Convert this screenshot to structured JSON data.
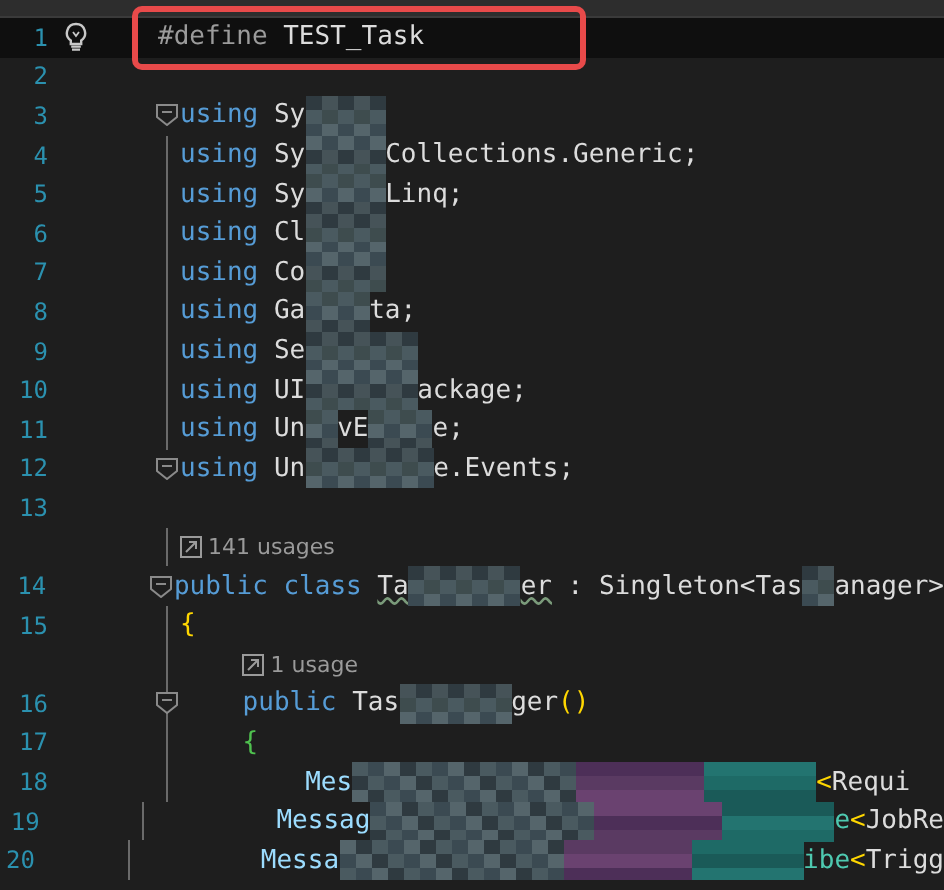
{
  "editor": {
    "rows": [
      {
        "kind": "code",
        "number": "1",
        "current": true,
        "annotated": true,
        "lightbulb": true,
        "fold_marker": false,
        "guide": false,
        "segments": [
          {
            "kind": "directive",
            "text": "#define"
          },
          {
            "kind": "plain",
            "text": " TEST_Task"
          }
        ]
      },
      {
        "kind": "code",
        "number": "2",
        "current": false,
        "annotated": false,
        "lightbulb": false,
        "fold_marker": false,
        "guide": false,
        "segments": []
      },
      {
        "kind": "code",
        "number": "3",
        "current": false,
        "annotated": false,
        "lightbulb": false,
        "fold_marker": true,
        "guide": false,
        "segments": [
          {
            "kind": "keyword",
            "text": "using"
          },
          {
            "kind": "plain",
            "text": " Sy"
          },
          {
            "kind": "blur5"
          }
        ]
      },
      {
        "kind": "code",
        "number": "4",
        "current": false,
        "annotated": false,
        "lightbulb": false,
        "fold_marker": false,
        "guide": true,
        "segments": [
          {
            "kind": "keyword",
            "text": "using"
          },
          {
            "kind": "plain",
            "text": " Sy"
          },
          {
            "kind": "blur5"
          },
          {
            "kind": "plain",
            "text": "Collections.Generic;"
          }
        ]
      },
      {
        "kind": "code",
        "number": "5",
        "current": false,
        "annotated": false,
        "lightbulb": false,
        "fold_marker": false,
        "guide": true,
        "segments": [
          {
            "kind": "keyword",
            "text": "using"
          },
          {
            "kind": "plain",
            "text": " Sy"
          },
          {
            "kind": "blur5"
          },
          {
            "kind": "plain",
            "text": "Linq;"
          }
        ]
      },
      {
        "kind": "code",
        "number": "6",
        "current": false,
        "annotated": false,
        "lightbulb": false,
        "fold_marker": false,
        "guide": true,
        "segments": [
          {
            "kind": "keyword",
            "text": "using"
          },
          {
            "kind": "plain",
            "text": " Cl"
          },
          {
            "kind": "blur5"
          }
        ]
      },
      {
        "kind": "code",
        "number": "7",
        "current": false,
        "annotated": false,
        "lightbulb": false,
        "fold_marker": false,
        "guide": true,
        "segments": [
          {
            "kind": "keyword",
            "text": "using"
          },
          {
            "kind": "plain",
            "text": " Co"
          },
          {
            "kind": "blur5"
          }
        ]
      },
      {
        "kind": "code",
        "number": "8",
        "current": false,
        "annotated": false,
        "lightbulb": false,
        "fold_marker": false,
        "guide": true,
        "segments": [
          {
            "kind": "keyword",
            "text": "using"
          },
          {
            "kind": "plain",
            "text": " Ga"
          },
          {
            "kind": "blur4"
          },
          {
            "kind": "plain",
            "text": "ta;"
          }
        ]
      },
      {
        "kind": "code",
        "number": "9",
        "current": false,
        "annotated": false,
        "lightbulb": false,
        "fold_marker": false,
        "guide": true,
        "segments": [
          {
            "kind": "keyword",
            "text": "using"
          },
          {
            "kind": "plain",
            "text": " Se"
          },
          {
            "kind": "blur7"
          }
        ]
      },
      {
        "kind": "code",
        "number": "10",
        "current": false,
        "annotated": false,
        "lightbulb": false,
        "fold_marker": false,
        "guide": true,
        "segments": [
          {
            "kind": "keyword",
            "text": "using"
          },
          {
            "kind": "plain",
            "text": " UI"
          },
          {
            "kind": "blur7"
          },
          {
            "kind": "plain",
            "text": "ackage;"
          }
        ]
      },
      {
        "kind": "code",
        "number": "11",
        "current": false,
        "annotated": false,
        "lightbulb": false,
        "fold_marker": false,
        "guide": true,
        "segments": [
          {
            "kind": "keyword",
            "text": "using"
          },
          {
            "kind": "plain",
            "text": " Un"
          },
          {
            "kind": "blur2"
          },
          {
            "kind": "plain",
            "text": "vE"
          },
          {
            "kind": "blur4"
          },
          {
            "kind": "plain",
            "text": "e;"
          }
        ]
      },
      {
        "kind": "code",
        "number": "12",
        "current": false,
        "annotated": false,
        "lightbulb": false,
        "fold_marker": true,
        "guide": false,
        "segments": [
          {
            "kind": "keyword",
            "text": "using"
          },
          {
            "kind": "plain",
            "text": " Un"
          },
          {
            "kind": "blur8"
          },
          {
            "kind": "plain",
            "text": "e.Events;"
          }
        ]
      },
      {
        "kind": "code",
        "number": "13",
        "current": false,
        "annotated": false,
        "lightbulb": false,
        "fold_marker": false,
        "guide": false,
        "segments": []
      },
      {
        "kind": "lens",
        "indented": false,
        "text": "141 usages"
      },
      {
        "kind": "code",
        "number": "14",
        "current": false,
        "annotated": false,
        "lightbulb": false,
        "fold_marker": true,
        "guide": false,
        "segments": [
          {
            "kind": "keyword",
            "text": "public class"
          },
          {
            "kind": "warning",
            "text": " Ta"
          },
          {
            "kind": "blur7"
          },
          {
            "kind": "warning",
            "text": "er"
          },
          {
            "kind": "plain",
            "text": " : Singleton<Tas"
          },
          {
            "kind": "blur2"
          },
          {
            "kind": "plain",
            "text": "anager>"
          }
        ]
      },
      {
        "kind": "code",
        "number": "15",
        "current": false,
        "annotated": false,
        "lightbulb": false,
        "fold_marker": false,
        "guide": true,
        "segments": [
          {
            "kind": "brace",
            "text": "{"
          }
        ]
      },
      {
        "kind": "lens",
        "indented": true,
        "text": "1 usage"
      },
      {
        "kind": "code",
        "number": "16",
        "current": false,
        "annotated": false,
        "lightbulb": false,
        "fold_marker": true,
        "guide": true,
        "segments": [
          {
            "kind": "keyword",
            "text": "    public"
          },
          {
            "kind": "plain",
            "text": " Tas"
          },
          {
            "kind": "blur7"
          },
          {
            "kind": "plain",
            "text": "ger"
          },
          {
            "kind": "brace",
            "text": "()"
          }
        ]
      },
      {
        "kind": "code",
        "number": "17",
        "current": false,
        "annotated": false,
        "lightbulb": false,
        "fold_marker": false,
        "guide": true,
        "segments": [
          {
            "kind": "innerbrace",
            "text": "    {"
          }
        ]
      },
      {
        "kind": "code",
        "number": "18",
        "current": false,
        "annotated": false,
        "lightbulb": false,
        "fold_marker": false,
        "guide": true,
        "segments": [
          {
            "kind": "member",
            "text": "        Mes"
          },
          {
            "kind": "blurwide"
          },
          {
            "kind": "brace",
            "text": "<"
          },
          {
            "kind": "plain",
            "text": "Requi"
          }
        ]
      },
      {
        "kind": "code",
        "number": "19",
        "current": false,
        "annotated": false,
        "lightbulb": false,
        "fold_marker": false,
        "guide": true,
        "segments": [
          {
            "kind": "member",
            "text": "        Messag"
          },
          {
            "kind": "blurwide"
          },
          {
            "kind": "type",
            "text": "e"
          },
          {
            "kind": "brace",
            "text": "<"
          },
          {
            "kind": "plain",
            "text": "JobRe"
          }
        ]
      },
      {
        "kind": "code",
        "number": "20",
        "current": false,
        "annotated": false,
        "lightbulb": false,
        "fold_marker": false,
        "guide": true,
        "segments": [
          {
            "kind": "member",
            "text": "        Messa"
          },
          {
            "kind": "blurwide"
          },
          {
            "kind": "type",
            "text": "ibe"
          },
          {
            "kind": "brace",
            "text": "<"
          },
          {
            "kind": "plain",
            "text": "Trigg"
          }
        ]
      }
    ]
  }
}
